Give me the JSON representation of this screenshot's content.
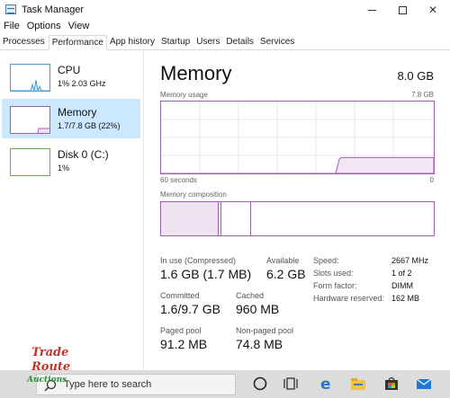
{
  "window": {
    "title": "Task Manager"
  },
  "menu": {
    "items": [
      "File",
      "Options",
      "View"
    ]
  },
  "tabs": [
    "Processes",
    "Performance",
    "App history",
    "Startup",
    "Users",
    "Details",
    "Services"
  ],
  "active_tab": "Performance",
  "sidebar": {
    "items": [
      {
        "name": "CPU",
        "value": "1% 2.03 GHz",
        "color": "#4a9bd1"
      },
      {
        "name": "Memory",
        "value": "1.7/7.8 GB (22%)",
        "color": "#9f5fb0"
      },
      {
        "name": "Disk 0 (C:)",
        "value": "1%",
        "color": "#6ab04c"
      }
    ]
  },
  "detail": {
    "title": "Memory",
    "total": "8.0 GB",
    "usage_label": "Memory usage",
    "usage_max": "7.8 GB",
    "time_left": "60 seconds",
    "time_right": "0",
    "composition_label": "Memory composition",
    "usage_fill_fraction": 0.22,
    "composition": {
      "in_use_fraction": 0.21,
      "modified_fraction": 0.01,
      "standby_fraction": 0.11
    },
    "stats": {
      "in_use": {
        "label": "In use (Compressed)",
        "value": "1.6 GB (1.7 MB)"
      },
      "available": {
        "label": "Available",
        "value": "6.2 GB"
      },
      "committed": {
        "label": "Committed",
        "value": "1.6/9.7 GB"
      },
      "cached": {
        "label": "Cached",
        "value": "960 MB"
      },
      "paged": {
        "label": "Paged pool",
        "value": "91.2 MB"
      },
      "nonpaged": {
        "label": "Non-paged pool",
        "value": "74.8 MB"
      }
    },
    "hardware": {
      "speed": {
        "label": "Speed:",
        "value": "2667 MHz"
      },
      "slots": {
        "label": "Slots used:",
        "value": "1 of 2"
      },
      "form": {
        "label": "Form factor:",
        "value": "DIMM"
      },
      "reserved": {
        "label": "Hardware reserved:",
        "value": "162 MB"
      }
    }
  },
  "taskbar": {
    "search_placeholder": "Type here to search",
    "icons": [
      "cortana-icon",
      "task-view-icon",
      "edge-icon",
      "file-explorer-icon",
      "store-icon",
      "mail-icon"
    ]
  },
  "watermark": {
    "line1": "Trade",
    "line2": "Route",
    "line3": "Auctions"
  },
  "colors": {
    "memory": "#9f5fb0",
    "selection": "#cce8ff",
    "taskbar": "#dcdcdc"
  }
}
